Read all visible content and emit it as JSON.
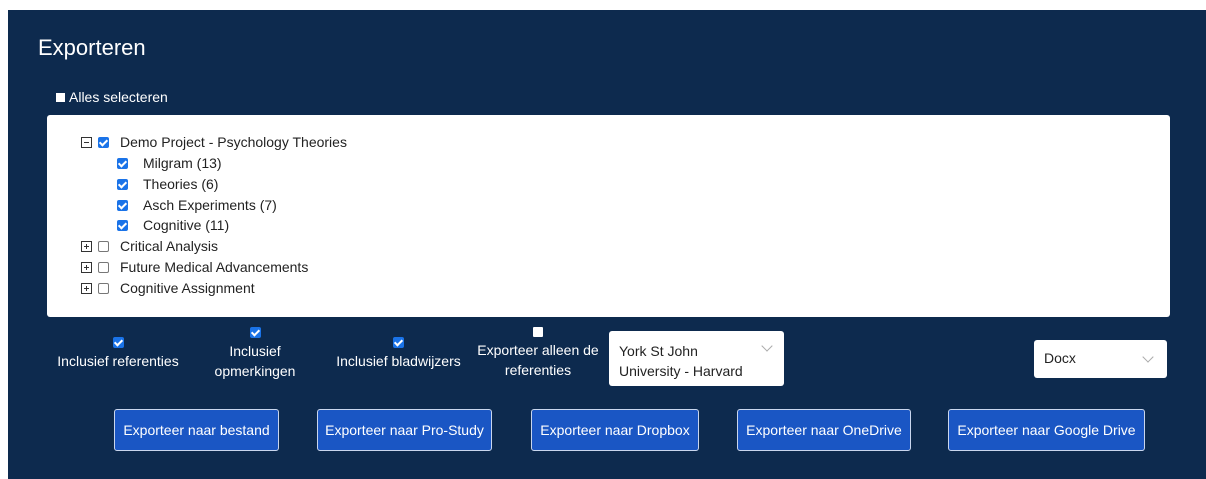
{
  "title": "Exporteren",
  "select_all": {
    "label": "Alles selecteren"
  },
  "tree": {
    "projects": [
      {
        "label": "Demo Project - Psychology Theories",
        "expanded": true,
        "checked": true,
        "children": [
          {
            "label": "Milgram (13)",
            "checked": true
          },
          {
            "label": "Theories (6)",
            "checked": true
          },
          {
            "label": "Asch Experiments (7)",
            "checked": true
          },
          {
            "label": "Cognitive (11)",
            "checked": true
          }
        ]
      },
      {
        "label": "Critical Analysis",
        "expanded": false,
        "checked": false
      },
      {
        "label": "Future Medical Advancements",
        "expanded": false,
        "checked": false
      },
      {
        "label": "Cognitive Assignment",
        "expanded": false,
        "checked": false
      }
    ]
  },
  "options": {
    "incl_refs": {
      "line1": "Inclusief referenties",
      "checked": true
    },
    "incl_comments": {
      "line1": "Inclusief",
      "line2": "opmerkingen",
      "checked": true
    },
    "incl_bookmarks": {
      "line1": "Inclusief bladwijzers",
      "checked": true
    },
    "refs_only": {
      "line1": "Exporteer alleen de",
      "line2": "referenties",
      "checked": false
    }
  },
  "citation_style": {
    "line1": "York St John",
    "line2": "University - Harvard"
  },
  "format": {
    "value": "Docx"
  },
  "buttons": {
    "file": "Exporteer naar bestand",
    "prostudy": "Exporteer naar Pro-Study",
    "dropbox": "Exporteer naar Dropbox",
    "onedrive": "Exporteer naar OneDrive",
    "gdrive": "Exporteer naar Google Drive"
  },
  "colors": {
    "panel": "#0d2a4e",
    "button": "#1a56c4",
    "checkbox": "#1a73e8"
  }
}
